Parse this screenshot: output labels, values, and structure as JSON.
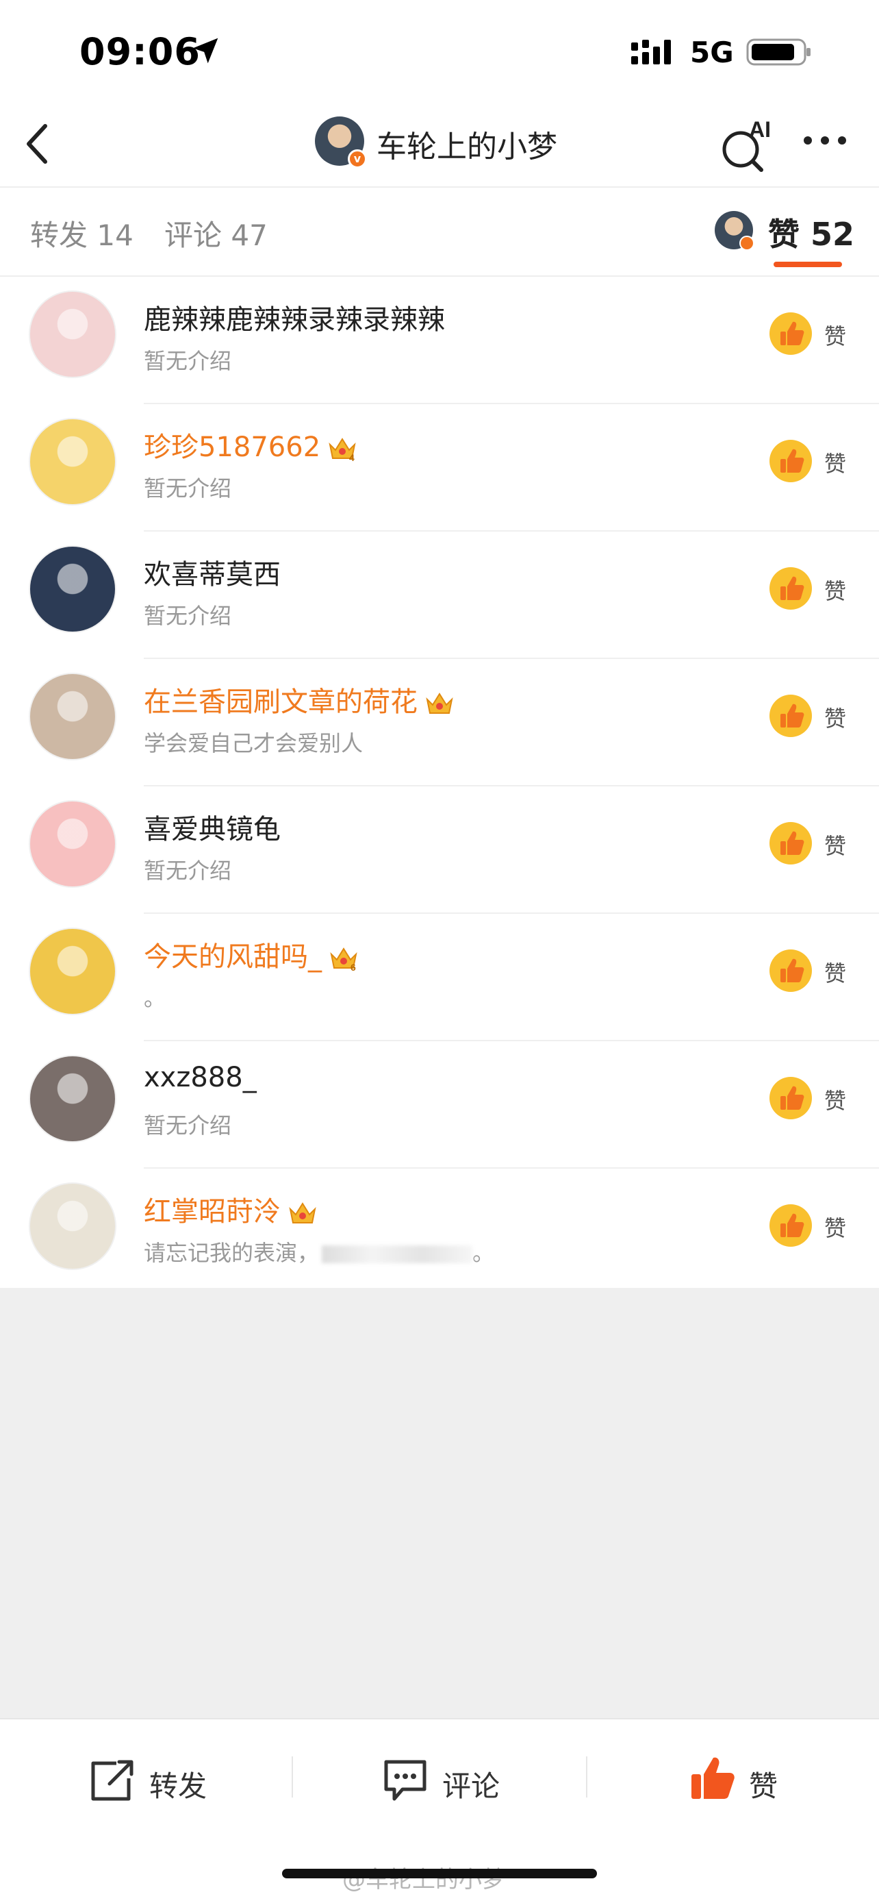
{
  "status_bar": {
    "time": "09:06",
    "network": "5G"
  },
  "nav": {
    "title": "车轮上的小梦",
    "ai_label": "AI"
  },
  "tabs": {
    "repost": "转发 14",
    "comment": "评论 47",
    "like": "赞 52"
  },
  "likers": [
    {
      "name": "鹿辣辣鹿辣辣录辣录辣辣",
      "desc": "暂无介绍",
      "vip": false,
      "badge": "",
      "avatar_color": "#f3d3d3"
    },
    {
      "name": "珍珍5187662",
      "desc": "暂无介绍",
      "vip": true,
      "badge": "4",
      "avatar_color": "#f5d36a"
    },
    {
      "name": "欢喜蒂莫西",
      "desc": "暂无介绍",
      "vip": false,
      "badge": "",
      "avatar_color": "#2c3b55"
    },
    {
      "name": "在兰香园刷文章的荷花",
      "desc": "学会爱自己才会爱别人",
      "vip": true,
      "badge": "",
      "avatar_color": "#cdb8a4"
    },
    {
      "name": "喜爱典镜龟",
      "desc": "暂无介绍",
      "vip": false,
      "badge": "",
      "avatar_color": "#f7c0c0"
    },
    {
      "name": "今天的风甜吗_",
      "desc": "。",
      "vip": true,
      "badge": "6",
      "avatar_color": "#f0c64a"
    },
    {
      "name": "xxz888_",
      "desc": "暂无介绍",
      "vip": false,
      "badge": "",
      "avatar_color": "#7a6e6a"
    },
    {
      "name": "红掌昭莳泠",
      "desc": "请忘记我的表演，",
      "desc_end": "。",
      "vip": true,
      "badge": "",
      "avatar_color": "#e9e3d6"
    }
  ],
  "like_label": "赞",
  "bottom_bar": {
    "repost": "转发",
    "comment": "评论",
    "like": "赞"
  },
  "watermark": "@车轮上的小梦",
  "colors": {
    "accent": "#f2561e",
    "vip_name": "#f07a1e",
    "like_yellow": "#f9c02e"
  }
}
